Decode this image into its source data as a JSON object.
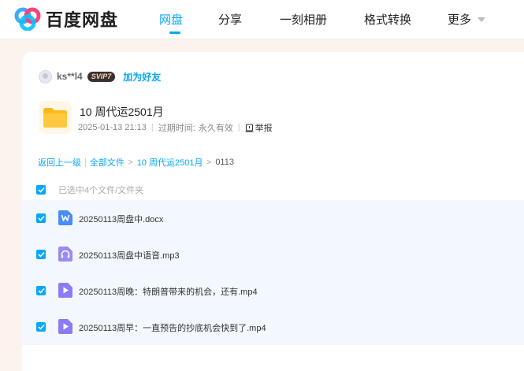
{
  "brand": {
    "name": "百度网盘",
    "logo_icon": "baidu-netdisk-logo"
  },
  "nav": {
    "items": [
      {
        "label": "网盘",
        "active": true
      },
      {
        "label": "分享",
        "active": false
      },
      {
        "label": "一刻相册",
        "active": false
      },
      {
        "label": "格式转换",
        "active": false
      },
      {
        "label": "更多",
        "active": false
      }
    ]
  },
  "sharer": {
    "username": "ks**l4",
    "badge": "SVIP7",
    "add_friend": "加为好友"
  },
  "share": {
    "title": "10 周代运2501月",
    "date": "2025-01-13 21:13",
    "expiry_label": "过期时间:",
    "expiry_value": "永久有效",
    "report": "举报"
  },
  "breadcrumb": {
    "back": "返回上一级",
    "all": "全部文件",
    "folder": "10 周代运2501月",
    "current": "0113"
  },
  "selection": {
    "text": "已选中4个文件/文件夹"
  },
  "files": [
    {
      "name": "20250113周盘中.docx",
      "icon": "word-doc-icon",
      "checked": true
    },
    {
      "name": "20250113周盘中语音.mp3",
      "icon": "audio-file-icon",
      "checked": true
    },
    {
      "name": "20250113周晚：特朗普带来的机会，还有.mp4",
      "icon": "video-file-icon",
      "checked": true
    },
    {
      "name": "20250113周早：一直预告的抄底机会快到了.mp4",
      "icon": "video-file-icon",
      "checked": true
    }
  ],
  "colors": {
    "accent": "#06a7ff",
    "folder": "#ffc53d",
    "video": "#8b7cf6",
    "audio": "#9b8af5",
    "word": "#4a8cf7"
  }
}
